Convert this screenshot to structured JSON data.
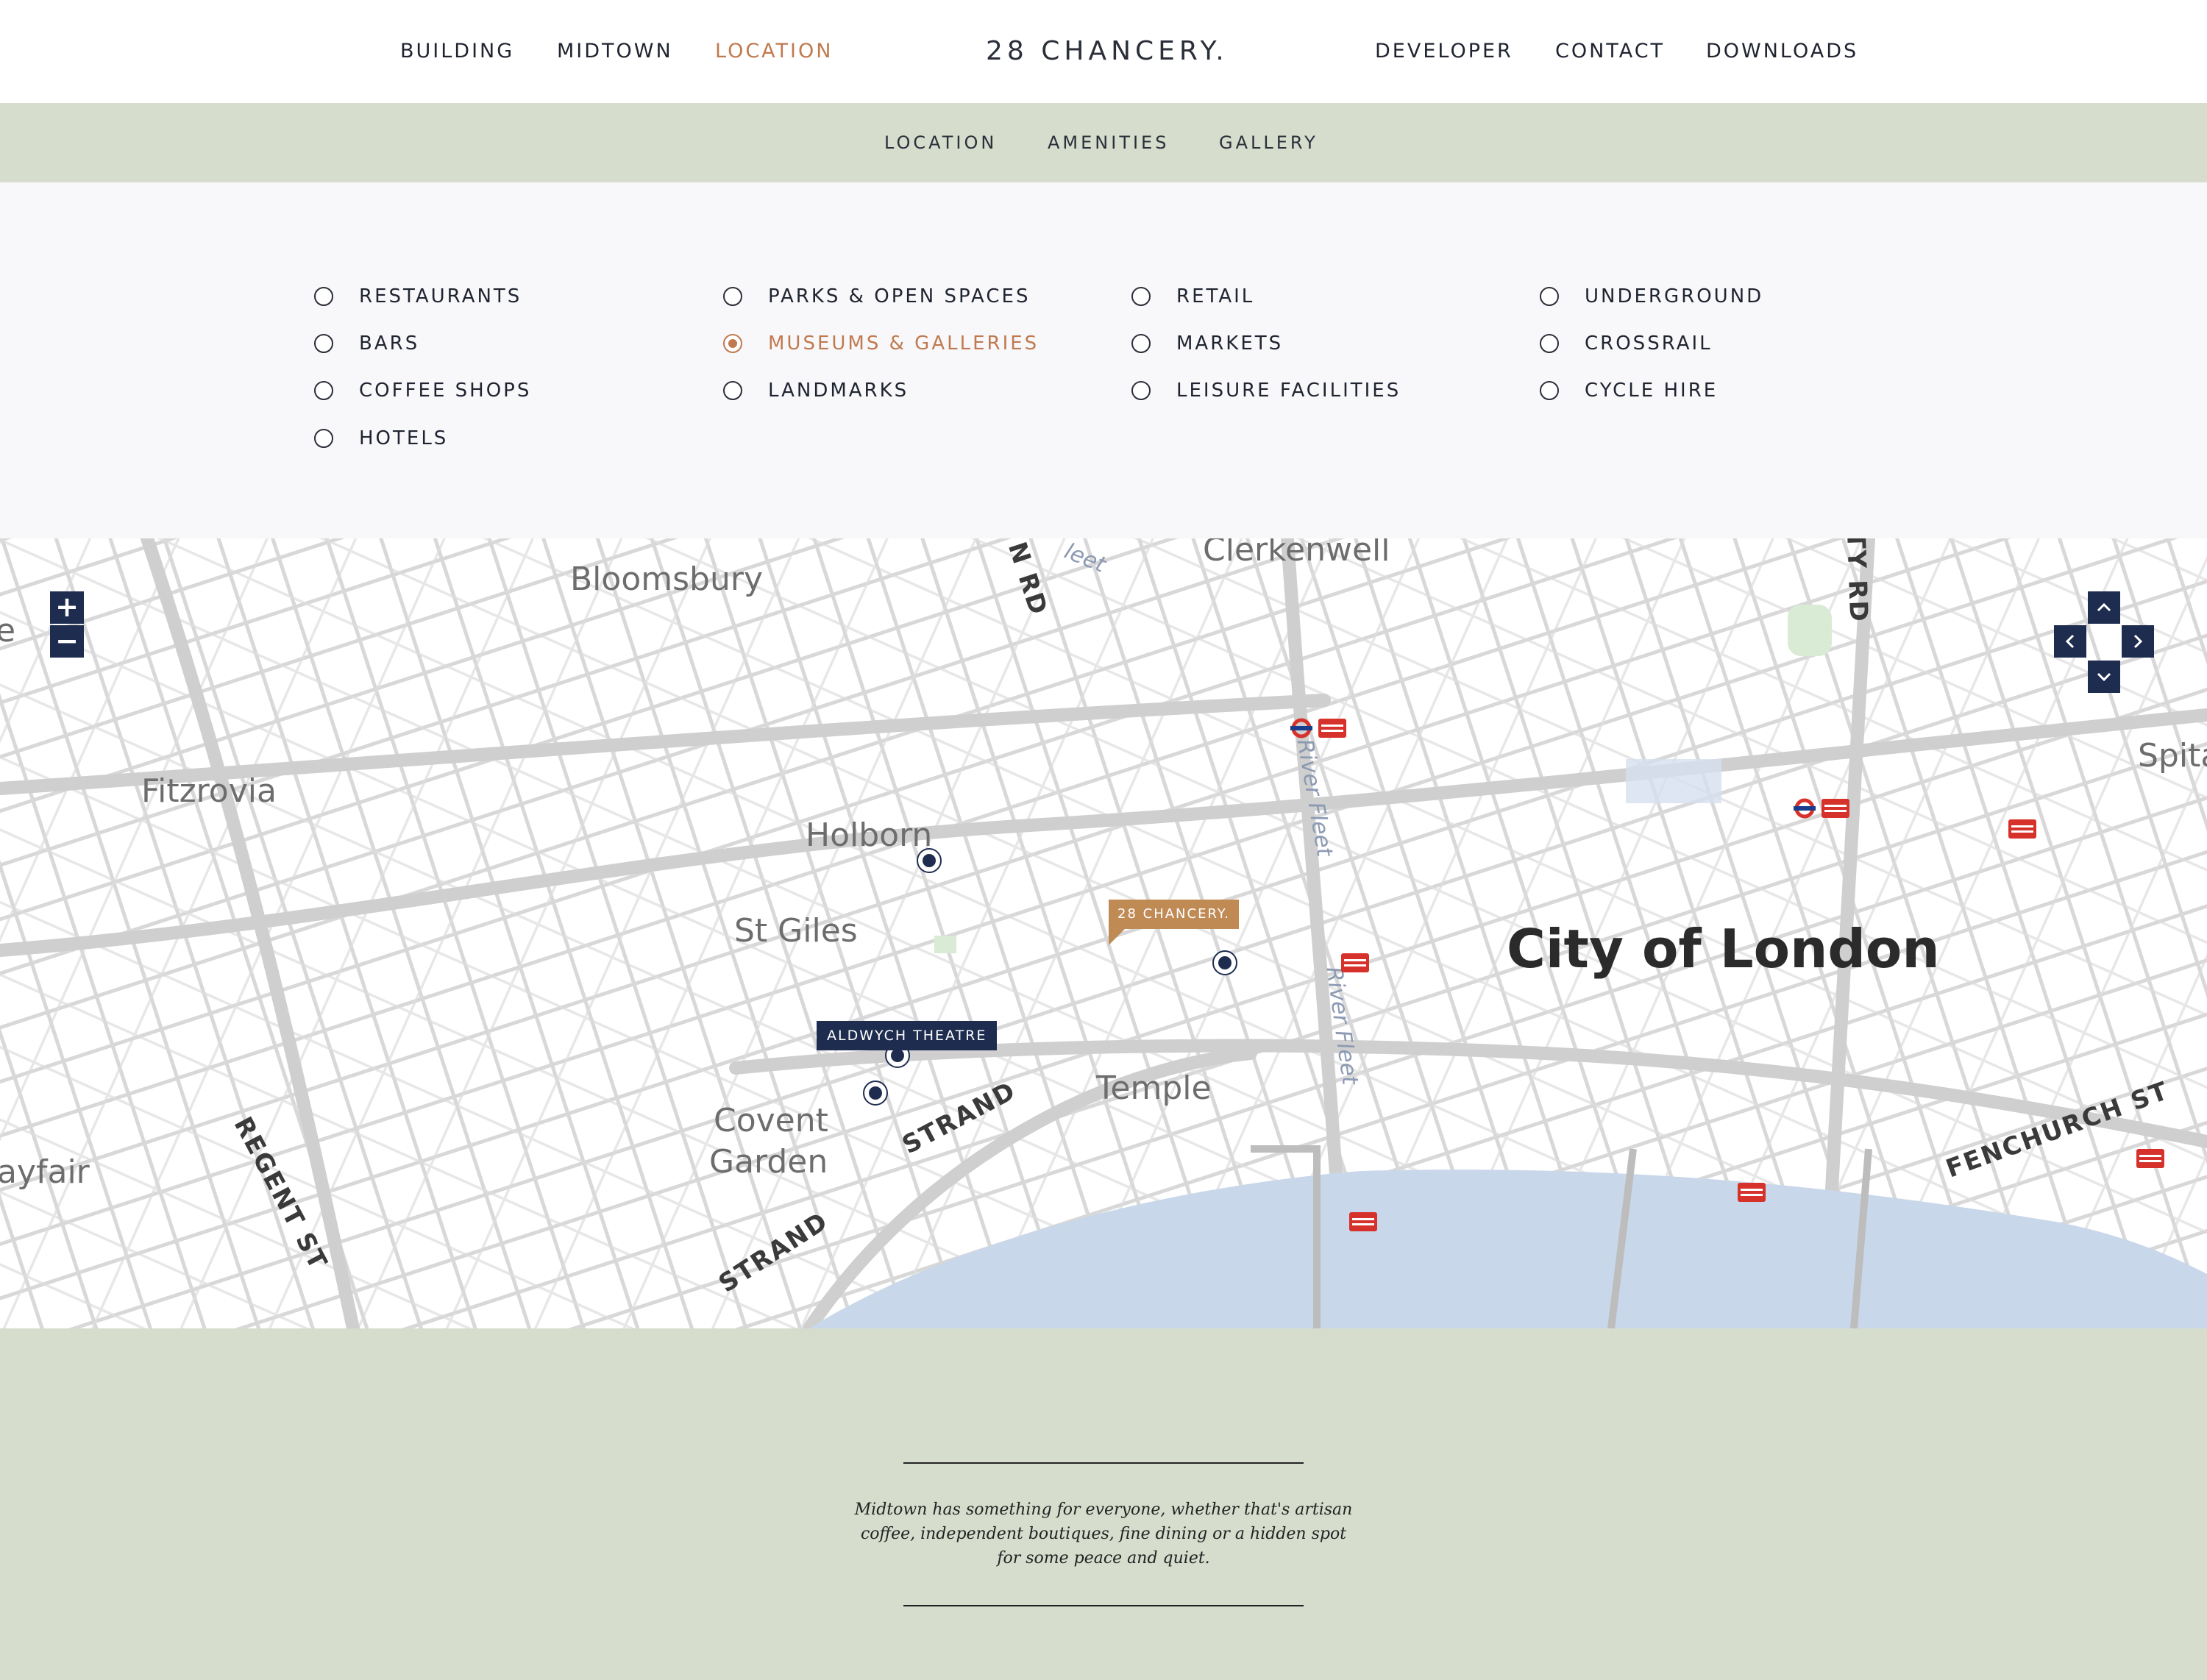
{
  "nav": {
    "left": [
      "BUILDING",
      "MIDTOWN",
      "LOCATION"
    ],
    "right": [
      "DEVELOPER",
      "CONTACT",
      "DOWNLOADS"
    ],
    "brand": "28 CHANCERY."
  },
  "subnav": [
    "LOCATION",
    "AMENITIES",
    "GALLERY"
  ],
  "filters": {
    "col1": [
      "RESTAURANTS",
      "BARS",
      "COFFEE SHOPS",
      "HOTELS"
    ],
    "col2": [
      "PARKS & OPEN SPACES",
      "MUSEUMS & GALLERIES",
      "LANDMARKS"
    ],
    "col3": [
      "RETAIL",
      "MARKETS",
      "LEISURE FACILITIES"
    ],
    "col4": [
      "UNDERGROUND",
      "CROSSRAIL",
      "CYCLE HIRE"
    ],
    "selected": "MUSEUMS & GALLERIES"
  },
  "map": {
    "areas": {
      "bloomsbury": "Bloomsbury",
      "clerkenwell": "Clerkenwell",
      "fitzrovia": "Fitzrovia",
      "holborn": "Holborn",
      "st_giles": "St Giles",
      "covent": "Covent",
      "garden": "Garden",
      "temple": "Temple",
      "city": "City of London",
      "mayfair": "ayfair",
      "spita": "Spita",
      "edge_e": "e"
    },
    "streets": {
      "strand_1": "STRAND",
      "strand_2": "STRAND",
      "regent": "REGENT ST",
      "fenchurch": "FENCHURCH ST",
      "rd_1": "N RD",
      "rd_2": "TY RD",
      "fleet_top": "leet"
    },
    "rivers": {
      "fleet_1": "River Fleet",
      "fleet_2": "River Fleet"
    },
    "marker_label": "ALDWYCH THEATRE",
    "building_label": "28 CHANCERY.",
    "zoom": {
      "in": "+",
      "out": "−"
    },
    "pan": {
      "up": "^",
      "down": "v",
      "left": "<",
      "right": ">"
    }
  },
  "footer": {
    "quote": "Midtown has something for everyone, whether that's artisan coffee, independent boutiques, fine dining or a hidden spot for some peace and quiet."
  },
  "colors": {
    "accent": "#c07a4f",
    "navy": "#1e2d4f",
    "sage": "#d6ddcd",
    "panel": "#f8f8fb",
    "river": "#c9d7ea",
    "brand_tag": "#c08a55"
  }
}
